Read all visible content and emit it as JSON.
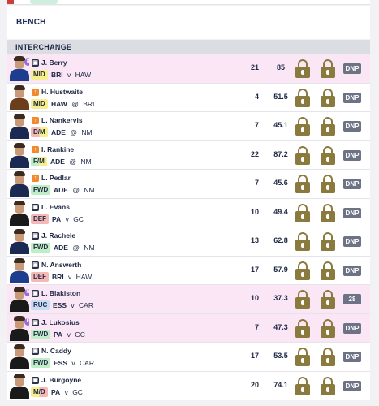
{
  "bench": {
    "title": "BENCH"
  },
  "interchange": {
    "title": "INTERCHANGE"
  },
  "players": [
    {
      "name": "J. Berry",
      "pos": "MID",
      "pos_class": "mid",
      "team": "BRI",
      "sep": "v",
      "opp": "HAW",
      "v1": "21",
      "v2": "85",
      "status": "DNP",
      "badge": "lock",
      "bench_num": "8",
      "highlight": true,
      "jersey": "#1f3d8f"
    },
    {
      "name": "H. Hustwaite",
      "pos": "MID",
      "pos_class": "mid",
      "team": "HAW",
      "sep": "@",
      "opp": "BRI",
      "v1": "4",
      "v2": "51.5",
      "status": "DNP",
      "badge": "up",
      "bench_num": "",
      "highlight": false,
      "jersey": "#6b3f1e"
    },
    {
      "name": "L. Nankervis",
      "pos": "D/M",
      "pos_class": "dm",
      "team": "ADE",
      "sep": "@",
      "opp": "NM",
      "v1": "7",
      "v2": "45.1",
      "status": "DNP",
      "badge": "up",
      "bench_num": "",
      "highlight": false,
      "jersey": "#1b2a52"
    },
    {
      "name": "I. Rankine",
      "pos": "F/M",
      "pos_class": "fm",
      "team": "ADE",
      "sep": "@",
      "opp": "NM",
      "v1": "22",
      "v2": "87.2",
      "status": "DNP",
      "badge": "up",
      "bench_num": "",
      "highlight": false,
      "jersey": "#1b2a52"
    },
    {
      "name": "L. Pedlar",
      "pos": "FWD",
      "pos_class": "fwd",
      "team": "ADE",
      "sep": "@",
      "opp": "NM",
      "v1": "7",
      "v2": "45.6",
      "status": "DNP",
      "badge": "up",
      "bench_num": "",
      "highlight": false,
      "jersey": "#1b2a52"
    },
    {
      "name": "L. Evans",
      "pos": "DEF",
      "pos_class": "def",
      "team": "PA",
      "sep": "v",
      "opp": "GC",
      "v1": "10",
      "v2": "49.4",
      "status": "DNP",
      "badge": "lock",
      "bench_num": "",
      "highlight": false,
      "jersey": "#1a1a1a"
    },
    {
      "name": "J. Rachele",
      "pos": "FWD",
      "pos_class": "fwd",
      "team": "ADE",
      "sep": "@",
      "opp": "NM",
      "v1": "13",
      "v2": "62.8",
      "status": "DNP",
      "badge": "lock",
      "bench_num": "",
      "highlight": false,
      "jersey": "#1b2a52"
    },
    {
      "name": "N. Answerth",
      "pos": "DEF",
      "pos_class": "def",
      "team": "BRI",
      "sep": "v",
      "opp": "HAW",
      "v1": "17",
      "v2": "57.9",
      "status": "DNP",
      "badge": "lock",
      "bench_num": "",
      "highlight": false,
      "jersey": "#1f3d8f"
    },
    {
      "name": "L. Blakiston",
      "pos": "RUC",
      "pos_class": "ruc",
      "team": "ESS",
      "sep": "v",
      "opp": "CAR",
      "v1": "10",
      "v2": "37.3",
      "status": "28",
      "badge": "lock",
      "bench_num": "R",
      "highlight": true,
      "jersey": "#1a1a1a"
    },
    {
      "name": "J. Lukosius",
      "pos": "FWD",
      "pos_class": "fwd",
      "team": "PA",
      "sep": "v",
      "opp": "GC",
      "v1": "7",
      "v2": "47.3",
      "status": "DNP",
      "badge": "lock",
      "bench_num": "F",
      "highlight": true,
      "jersey": "#1a1a1a"
    },
    {
      "name": "N. Caddy",
      "pos": "FWD",
      "pos_class": "fwd",
      "team": "ESS",
      "sep": "v",
      "opp": "CAR",
      "v1": "17",
      "v2": "53.5",
      "status": "DNP",
      "badge": "lock",
      "bench_num": "",
      "highlight": false,
      "jersey": "#1a1a1a"
    },
    {
      "name": "J. Burgoyne",
      "pos": "M/D",
      "pos_class": "md",
      "team": "PA",
      "sep": "v",
      "opp": "GC",
      "v1": "20",
      "v2": "74.1",
      "status": "DNP",
      "badge": "lock",
      "bench_num": "",
      "highlight": false,
      "jersey": "#1a1a1a"
    }
  ]
}
